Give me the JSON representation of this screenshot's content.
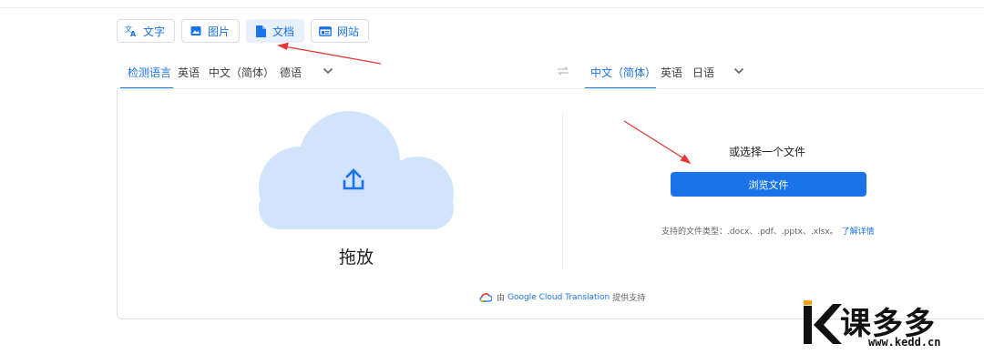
{
  "modes": [
    {
      "label": "文字",
      "icon": "translate-icon",
      "active": false
    },
    {
      "label": "图片",
      "icon": "image-icon",
      "active": false
    },
    {
      "label": "文档",
      "icon": "document-icon",
      "active": true
    },
    {
      "label": "网站",
      "icon": "website-icon",
      "active": false
    }
  ],
  "source_langs": [
    "检测语言",
    "英语",
    "中文（简体）",
    "德语"
  ],
  "target_langs": [
    "中文（简体）",
    "英语",
    "日语"
  ],
  "drop_text": "拖放",
  "choose_text": "或选择一个文件",
  "browse_label": "浏览文件",
  "support_text": "支持的文件类型：.docx、.pdf、.pptx、.xlsx。",
  "learn_more": "了解详情",
  "powered": {
    "prefix": "由",
    "brand": "Google Cloud Translation",
    "suffix": "提供支持"
  },
  "watermark": {
    "text": "课多多",
    "url": "www.kedd.cn"
  },
  "colors": {
    "accent": "#1a73e8",
    "active_tab_bg": "#e8f0fe",
    "cloud": "#d2e3fc",
    "annotation": "#e53935"
  }
}
